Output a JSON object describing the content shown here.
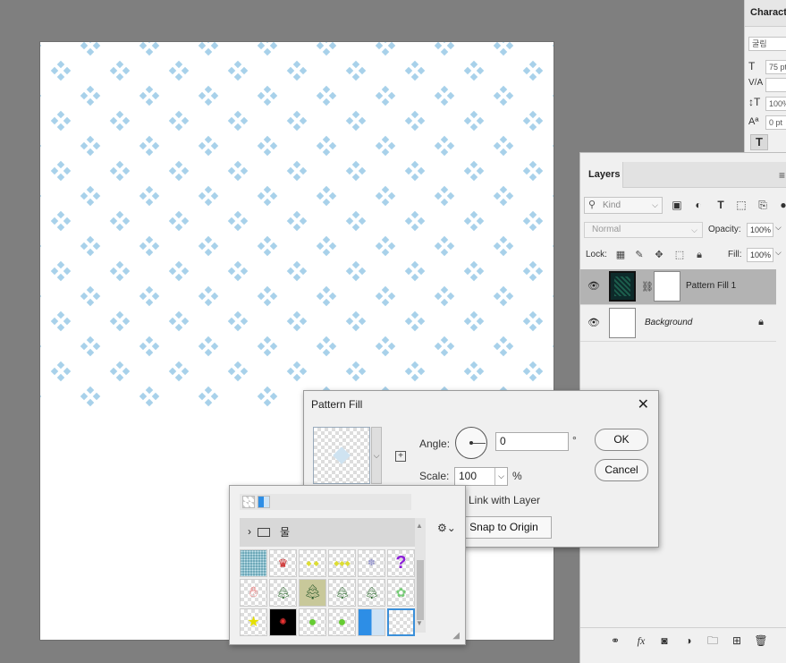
{
  "character_panel": {
    "tab_label": "Characte",
    "font_value": "굴림",
    "size_value": "75 pt",
    "scale_value": "100%",
    "baseline_value": "0 pt",
    "collapse_glyph": "«"
  },
  "layers_panel": {
    "tab_label": "Layers",
    "kind_placeholder": "Kind",
    "blend_mode": "Normal",
    "opacity_label": "Opacity:",
    "opacity_value": "100%",
    "lock_label": "Lock:",
    "fill_label": "Fill:",
    "fill_value": "100%",
    "layers": [
      {
        "name": "Pattern Fill 1",
        "selected": true,
        "visible": true
      },
      {
        "name": "Background",
        "selected": false,
        "visible": true,
        "locked": true
      }
    ]
  },
  "pattern_dialog": {
    "title": "Pattern Fill",
    "angle_label": "Angle:",
    "angle_value": "0",
    "angle_unit": "°",
    "scale_label": "Scale:",
    "scale_value": "100",
    "scale_unit": "%",
    "link_label": "Link with Layer",
    "snap_label": "Snap to Origin",
    "ok_label": "OK",
    "cancel_label": "Cancel"
  },
  "pattern_picker": {
    "group_name": "물"
  },
  "colors": {
    "motif": "#a8d1ea",
    "selection": "#3a8fd9",
    "workspace": "#7f7f7f"
  }
}
